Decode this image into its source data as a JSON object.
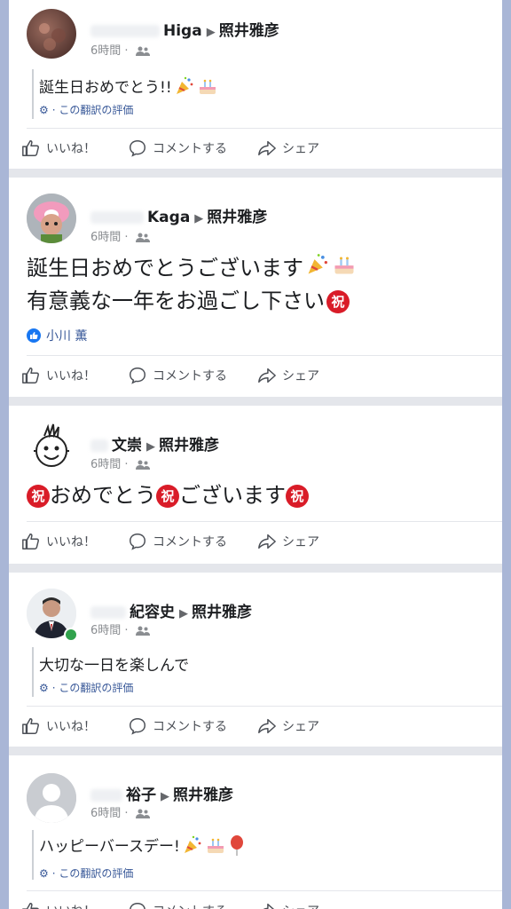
{
  "shared": {
    "target": "照井雅彦",
    "time": "6時間",
    "dot": "·",
    "translate_label": "この翻訳の評価",
    "like_label": "いいね！",
    "comment_label": "コメントする",
    "share_label": "シェア"
  },
  "posts": [
    {
      "author": "Higa",
      "message": "誕生日おめでとう!!"
    },
    {
      "author": "Kaga",
      "message_line1": "誕生日おめでとうございます",
      "message_line2": "有意義な一年をお過ごし下さい",
      "reactor": "小川 薫"
    },
    {
      "author": "文崇",
      "message_a": "おめでとう",
      "message_b": "ございます",
      "iwai_char": "祝"
    },
    {
      "author": "紀容史",
      "message": "大切な一日を楽しんで"
    },
    {
      "author": "裕子",
      "message": "ハッピーバースデー!"
    }
  ],
  "icons": [
    "gear-icon",
    "like-icon",
    "comment-icon",
    "share-icon",
    "friends-icon",
    "party-popper-emoji",
    "cake-emoji",
    "balloon-emoji"
  ]
}
